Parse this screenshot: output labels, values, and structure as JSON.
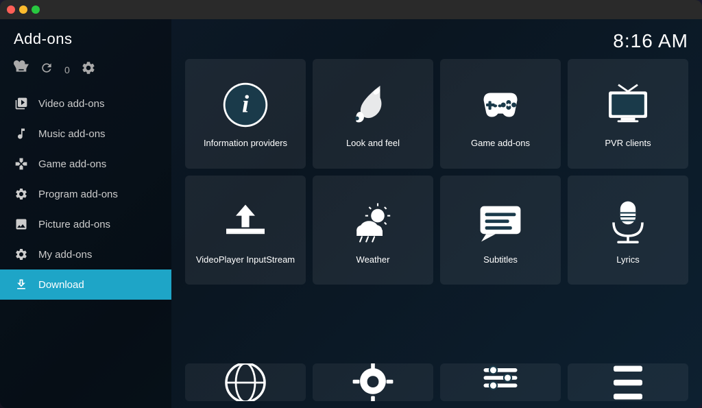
{
  "titlebar": {
    "buttons": [
      "close",
      "minimize",
      "maximize"
    ]
  },
  "header": {
    "title": "Add-ons",
    "time": "8:16 AM"
  },
  "toolbar": {
    "install_label": "install",
    "update_count": "0",
    "settings_label": "settings"
  },
  "sidebar": {
    "items": [
      {
        "id": "video",
        "label": "Video add-ons",
        "icon": "video-icon"
      },
      {
        "id": "music",
        "label": "Music add-ons",
        "icon": "music-icon"
      },
      {
        "id": "game",
        "label": "Game add-ons",
        "icon": "game-icon"
      },
      {
        "id": "program",
        "label": "Program add-ons",
        "icon": "program-icon"
      },
      {
        "id": "picture",
        "label": "Picture add-ons",
        "icon": "picture-icon"
      },
      {
        "id": "myaddon",
        "label": "My add-ons",
        "icon": "myaddon-icon"
      },
      {
        "id": "download",
        "label": "Download",
        "icon": "download-icon",
        "active": true
      }
    ]
  },
  "grid": {
    "items": [
      {
        "id": "info-providers",
        "label": "Information providers",
        "icon": "info-icon"
      },
      {
        "id": "look-feel",
        "label": "Look and feel",
        "icon": "paint-icon"
      },
      {
        "id": "game-addons",
        "label": "Game add-ons",
        "icon": "gamepad-icon"
      },
      {
        "id": "pvr-clients",
        "label": "PVR clients",
        "icon": "tv-icon"
      },
      {
        "id": "videoplayer",
        "label": "VideoPlayer InputStream",
        "icon": "upload-icon"
      },
      {
        "id": "weather",
        "label": "Weather",
        "icon": "weather-icon"
      },
      {
        "id": "subtitles",
        "label": "Subtitles",
        "icon": "subtitles-icon"
      },
      {
        "id": "lyrics",
        "label": "Lyrics",
        "icon": "mic-icon"
      },
      {
        "id": "partial1",
        "label": "",
        "icon": "globe-partial"
      },
      {
        "id": "partial2",
        "label": "",
        "icon": "gear-partial"
      },
      {
        "id": "partial3",
        "label": "",
        "icon": "settings-partial"
      },
      {
        "id": "partial4",
        "label": "",
        "icon": "tool-partial"
      }
    ]
  }
}
